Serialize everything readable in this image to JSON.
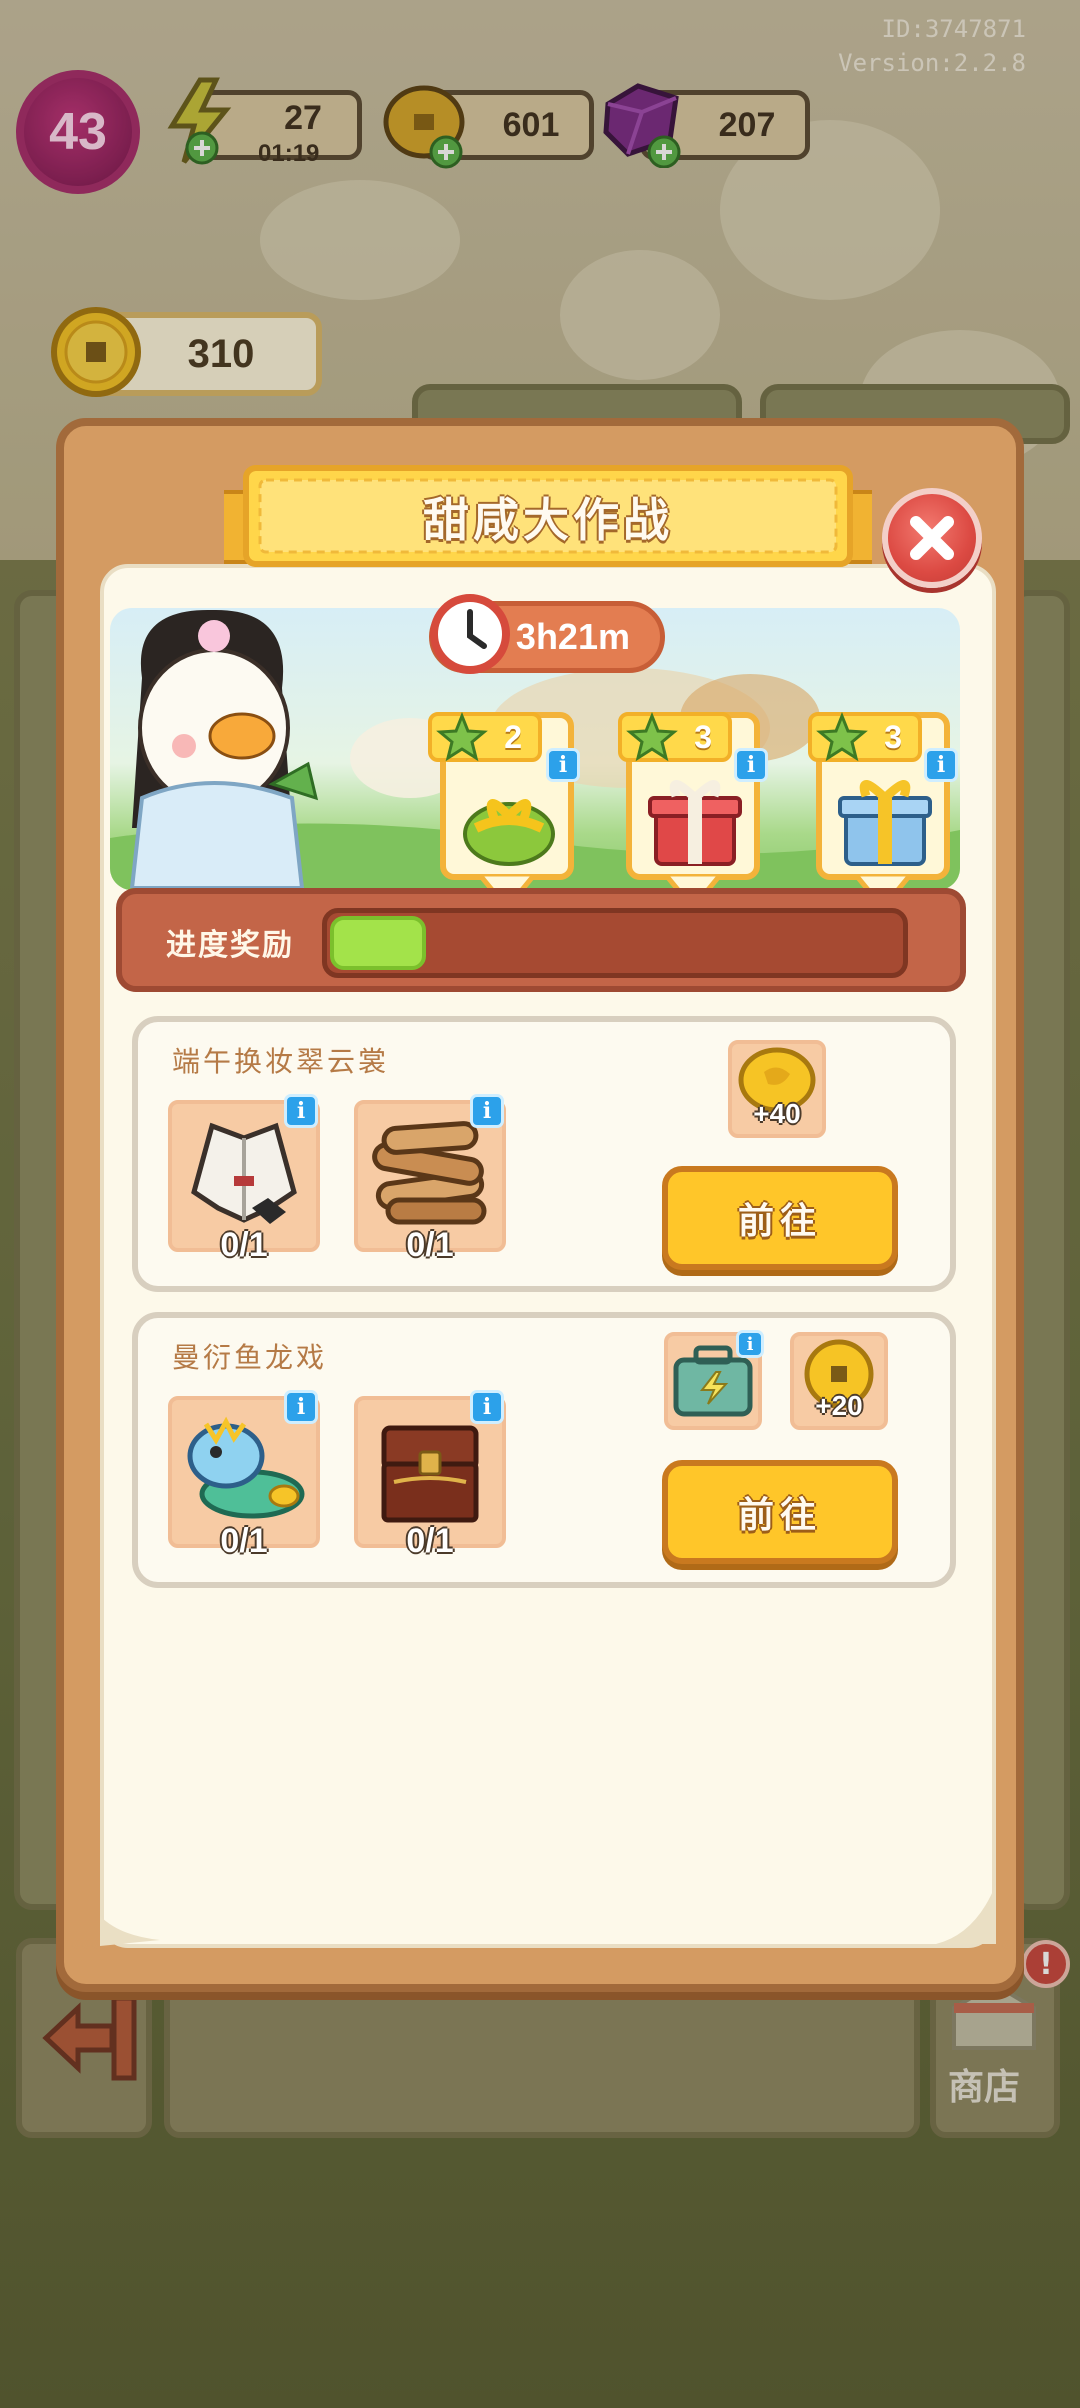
{
  "hud": {
    "player_id": "ID:3747871",
    "version": "Version:2.2.8",
    "level": "43",
    "energy": "27",
    "energy_timer": "01:19",
    "gold": "601",
    "gems": "207",
    "coins": "310"
  },
  "event": {
    "title": "甜咸大作战",
    "timer": "3h21m",
    "progress_label": "进度奖励",
    "progress": 0.08,
    "milestones": [
      {
        "stars": "2",
        "gift": "green-gift-box"
      },
      {
        "stars": "3",
        "gift": "red-gift-box"
      },
      {
        "stars": "3",
        "gift": "blue-gift-box"
      }
    ]
  },
  "tasks": [
    {
      "title": "端午换妆翠云裳",
      "items": [
        {
          "icon": "robe-icon",
          "count": "0/1"
        },
        {
          "icon": "firewood-icon",
          "count": "0/1"
        }
      ],
      "rewards": [
        {
          "icon": "coin-icon",
          "amount": "+40"
        }
      ],
      "button": "前往"
    },
    {
      "title": "曼衍鱼龙戏",
      "items": [
        {
          "icon": "dragon-icon",
          "count": "0/1"
        },
        {
          "icon": "chest-icon",
          "count": "0/1"
        }
      ],
      "rewards": [
        {
          "icon": "energy-case-icon",
          "amount": ""
        },
        {
          "icon": "coin-icon",
          "amount": "+20"
        }
      ],
      "button": "前往"
    }
  ],
  "bottom": {
    "shop_label": "商店",
    "shop_alert": "!"
  },
  "colors": {
    "modal_frame": "#d49b62",
    "title_banner": "#ffd64a",
    "go_button": "#ffc629",
    "progress_fill": "#a3e34a",
    "close_button": "#dc4a43"
  }
}
